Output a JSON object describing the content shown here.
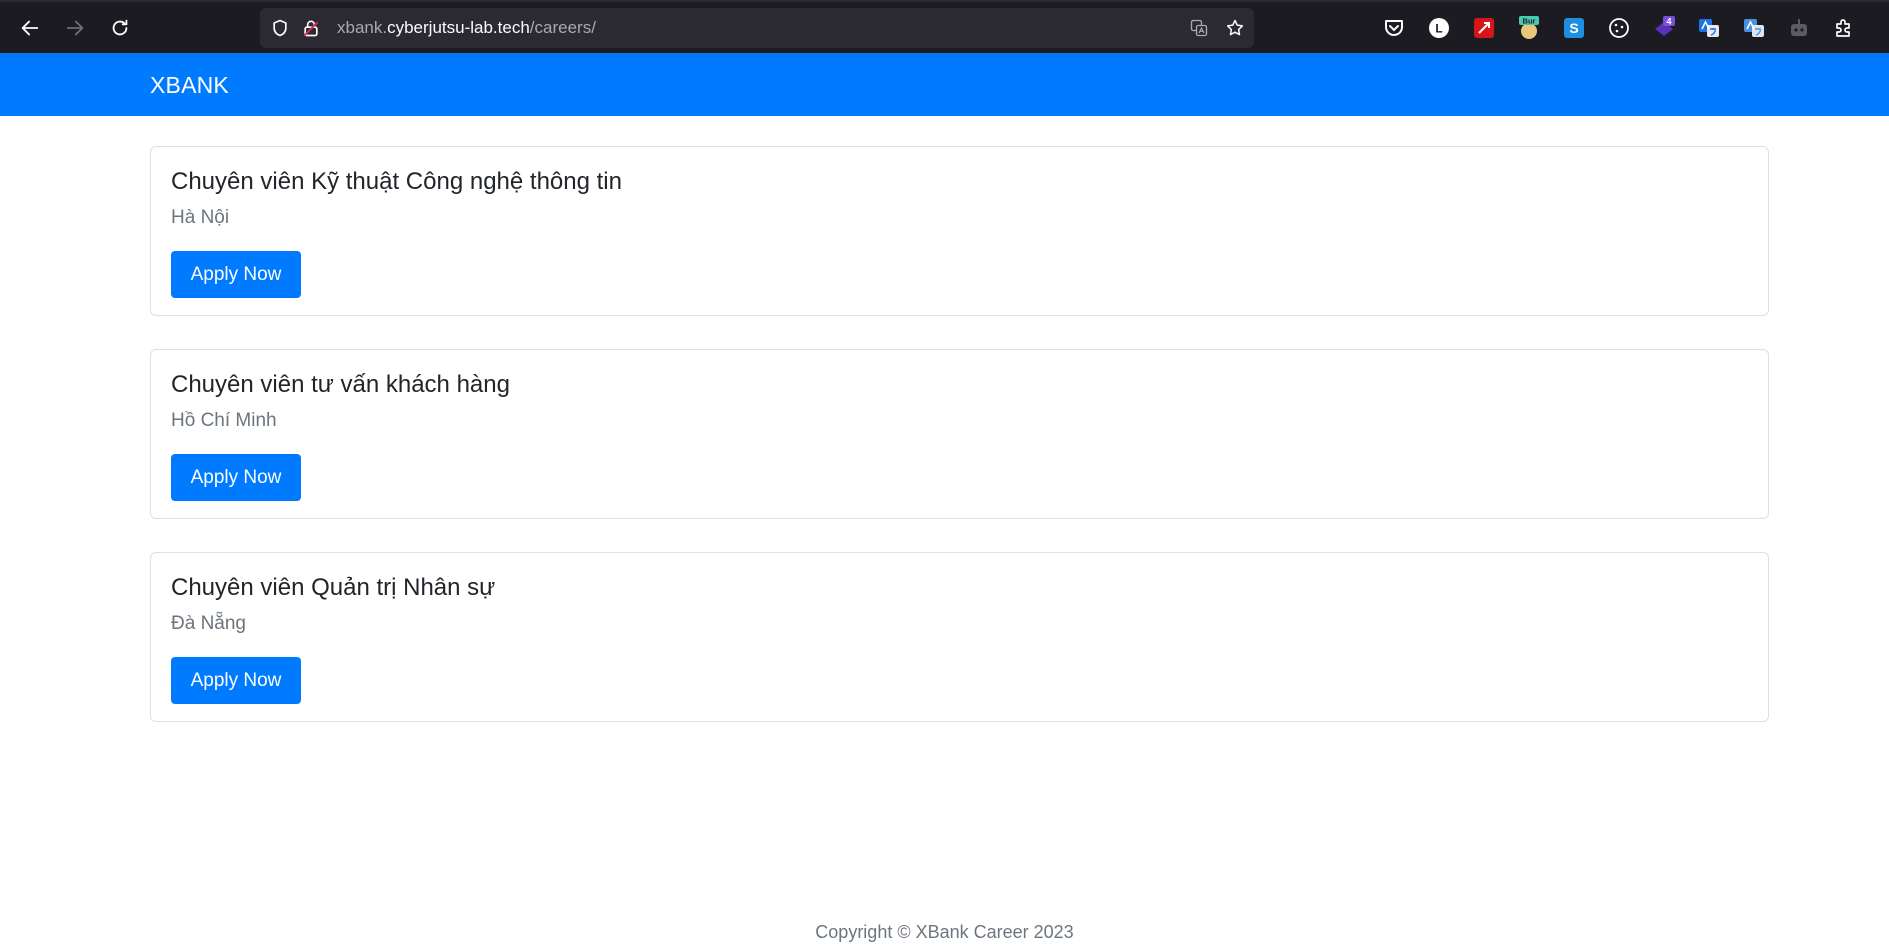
{
  "browser": {
    "url_host_prefix": "xbank.",
    "url_host_main": "cyberjutsu-lab.tech",
    "url_path": "/careers/",
    "extensions": [
      {
        "name": "pocket-icon",
        "label": ""
      },
      {
        "name": "extension-l-icon",
        "label": "L"
      },
      {
        "name": "extension-red-icon",
        "label": ""
      },
      {
        "name": "burp-icon",
        "label": "Bur"
      },
      {
        "name": "extension-s-icon",
        "label": "S"
      },
      {
        "name": "cookie-icon",
        "label": ""
      },
      {
        "name": "extension-badge-icon",
        "label": "4"
      },
      {
        "name": "translate-icon",
        "label": ""
      },
      {
        "name": "translate-alt-icon",
        "label": ""
      },
      {
        "name": "robot-icon",
        "label": ""
      },
      {
        "name": "extensions-puzzle-icon",
        "label": ""
      }
    ]
  },
  "header": {
    "brand": "XBANK"
  },
  "jobs": [
    {
      "title": "Chuyên viên Kỹ thuật Công nghệ thông tin",
      "location": "Hà Nội",
      "button": "Apply Now"
    },
    {
      "title": "Chuyên viên tư vấn khách hàng",
      "location": "Hồ Chí Minh",
      "button": "Apply Now"
    },
    {
      "title": "Chuyên viên Quản trị Nhân sự",
      "location": "Đà Nẵng",
      "button": "Apply Now"
    }
  ],
  "footer": {
    "text": "Copyright © XBank Career 2023"
  },
  "colors": {
    "primary": "#007bff",
    "chrome": "#1c1b22",
    "urlbar": "#2b2a33"
  }
}
